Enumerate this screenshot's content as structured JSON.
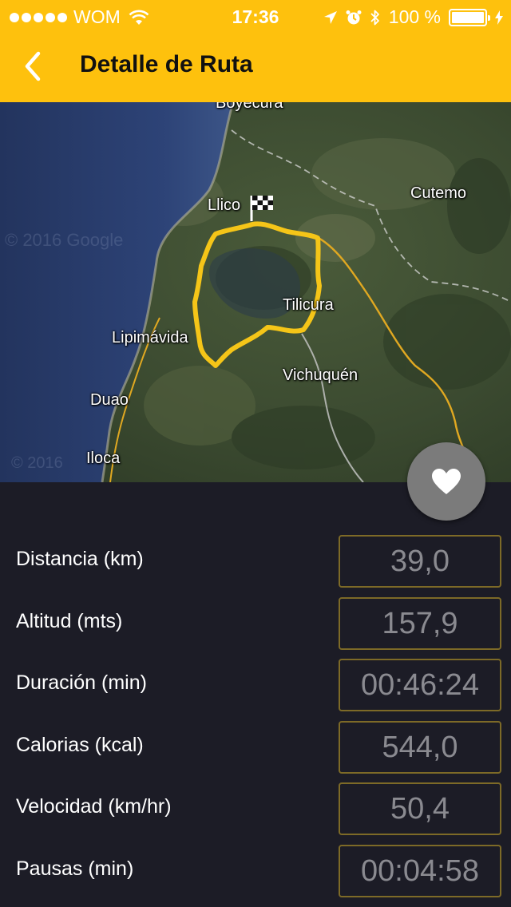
{
  "status_bar": {
    "carrier": "WOM",
    "time": "17:36",
    "battery": "100 %"
  },
  "nav": {
    "title": "Detalle de Ruta"
  },
  "map": {
    "places": {
      "boyecura": "Boyecura",
      "llico": "Llico",
      "cutemo": "Cutemo",
      "tilicura": "Tilicura",
      "lipimavida": "Lipimávida",
      "vichuquen": "Vichuquén",
      "duao": "Duao",
      "iloca": "Iloca"
    },
    "route_color": "#f5c518"
  },
  "stats": [
    {
      "label": "Distancia (km)",
      "value": "39,0"
    },
    {
      "label": "Altitud (mts)",
      "value": "157,9"
    },
    {
      "label": "Duración (min)",
      "value": "00:46:24"
    },
    {
      "label": "Calorias (kcal)",
      "value": "544,0"
    },
    {
      "label": "Velocidad (km/hr)",
      "value": "50,4"
    },
    {
      "label": "Pausas (min)",
      "value": "00:04:58"
    }
  ],
  "colors": {
    "header": "#fec10d",
    "background": "#1c1c26",
    "box_border": "#7d6a27",
    "value_text": "#8a8a90"
  }
}
